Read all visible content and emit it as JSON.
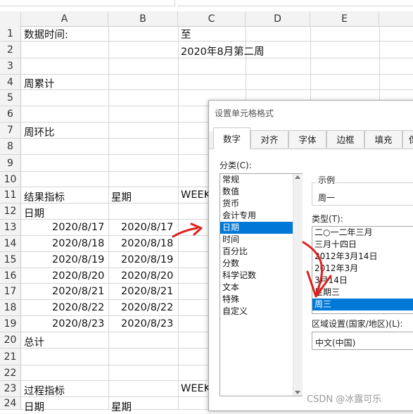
{
  "spreadsheet": {
    "columns": [
      "A",
      "B",
      "C",
      "D",
      "E"
    ],
    "rows": [
      "1",
      "2",
      "3",
      "4",
      "5",
      "6",
      "7",
      "8",
      "9",
      "10",
      "11",
      "12",
      "13",
      "14",
      "15",
      "16",
      "17",
      "18",
      "19",
      "20",
      "21",
      "22",
      "23",
      "24"
    ],
    "cells": {
      "a1": "数据时间:",
      "c1": "至",
      "c2": "2020年8月第二周",
      "a4": "周累计",
      "a7": "周环比",
      "a11": "结果指标",
      "b11": "星期",
      "c11": "WEEK",
      "a12": "日期",
      "a13": "2020/8/17",
      "b13": "2020/8/17",
      "a14": "2020/8/18",
      "b14": "2020/8/18",
      "a15": "2020/8/19",
      "b15": "2020/8/19",
      "a16": "2020/8/20",
      "b16": "2020/8/20",
      "a17": "2020/8/21",
      "b17": "2020/8/21",
      "a18": "2020/8/22",
      "b18": "2020/8/22",
      "a19": "2020/8/23",
      "b19": "2020/8/23",
      "a20": "总计",
      "a23": "过程指标",
      "c23": "WEEK",
      "a24": "日期",
      "b24": "星期"
    }
  },
  "dialog": {
    "title": "设置单元格格式",
    "tabs": [
      "数字",
      "对齐",
      "字体",
      "边框",
      "填充",
      "保"
    ],
    "category_label": "分类(C):",
    "categories": [
      "常规",
      "数值",
      "货币",
      "会计专用",
      "日期",
      "时间",
      "百分比",
      "分数",
      "科学记数",
      "文本",
      "特殊",
      "自定义"
    ],
    "selected_category": "日期",
    "sample_label": "示例",
    "sample_value": "周一",
    "type_label": "类型(T):",
    "types": [
      "二○一二年三月",
      "三月十四日",
      "2012年3月14日",
      "2012年3月",
      "3月14日",
      "星期三",
      "周三"
    ],
    "selected_type": "周三",
    "locale_label": "区域设置(国家/地区)(L):",
    "locale_value": "中文(中国)"
  },
  "watermark": "CSDN @冰露可乐",
  "colors": {
    "selection": "#0078d7",
    "annotation": "#e02020",
    "grid": "#d6d6d6",
    "header_bg": "#f3f3f3"
  }
}
